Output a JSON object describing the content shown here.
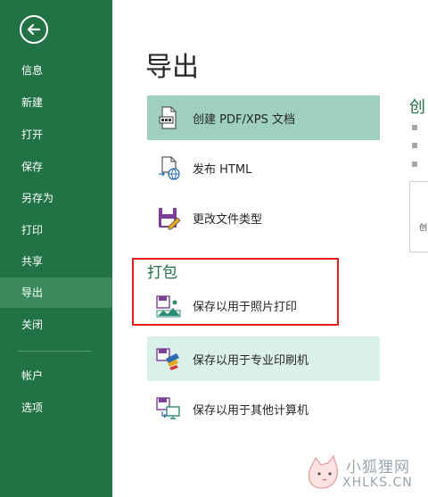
{
  "sidebar": {
    "items": [
      {
        "label": "信息"
      },
      {
        "label": "新建"
      },
      {
        "label": "打开"
      },
      {
        "label": "保存"
      },
      {
        "label": "另存为"
      },
      {
        "label": "打印"
      },
      {
        "label": "共享"
      },
      {
        "label": "导出"
      },
      {
        "label": "关闭"
      },
      {
        "label": "帐户"
      },
      {
        "label": "选项"
      }
    ]
  },
  "main": {
    "title": "导出",
    "options": [
      {
        "label": "创建 PDF/XPS 文档",
        "icon": "pdf-document-icon"
      },
      {
        "label": "发布 HTML",
        "icon": "html-publish-icon"
      },
      {
        "label": "更改文件类型",
        "icon": "change-file-type-icon"
      }
    ],
    "section": "打包",
    "pack_options": [
      {
        "label": "保存以用于照片打印",
        "icon": "photo-print-icon"
      },
      {
        "label": "保存以用于专业印刷机",
        "icon": "commercial-printer-icon"
      },
      {
        "label": "保存以用于其他计算机",
        "icon": "other-computer-icon"
      }
    ]
  },
  "right": {
    "title": "创",
    "card_text": "创"
  },
  "watermark": {
    "line1": "小狐狸网",
    "line2": "XHLKS.CN"
  },
  "colors": {
    "sidebar": "#217346",
    "active": "#3a8a5d",
    "selected": "#9ecfc1",
    "hover": "#dcf0ea",
    "highlight_border": "#e02020"
  }
}
